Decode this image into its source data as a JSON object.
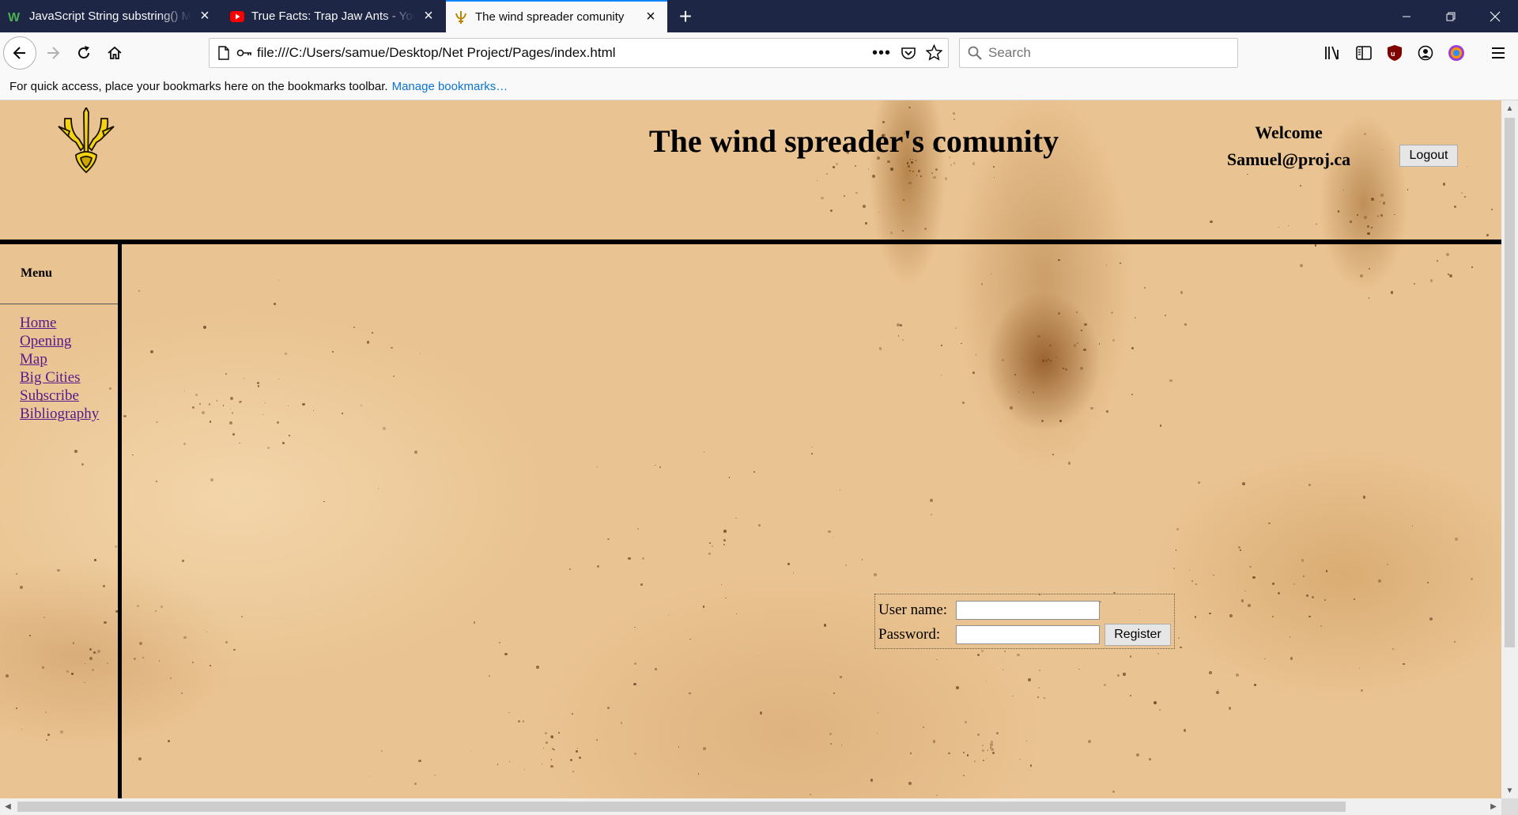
{
  "browser": {
    "tabs": [
      {
        "title": "JavaScript String substring() Me",
        "favicon": "w3schools-icon",
        "active": false
      },
      {
        "title": "True Facts: Trap Jaw Ants - YouT",
        "favicon": "youtube-icon",
        "active": false
      },
      {
        "title": "The wind spreader comunity",
        "favicon": "trident-icon",
        "active": true
      }
    ],
    "url": "file:///C:/Users/samue/Desktop/Net Project/Pages/index.html",
    "search_placeholder": "Search",
    "bookmarks_hint": "For quick access, place your bookmarks here on the bookmarks toolbar.",
    "bookmarks_link": "Manage bookmarks…",
    "colors": {
      "tabstrip": "#1d2645",
      "accent": "#0a84ff",
      "link": "#0a74d0"
    }
  },
  "page": {
    "title": "The wind spreader's comunity",
    "welcome": {
      "line1": "Welcome",
      "line2": "Samuel@proj.ca"
    },
    "logout_label": "Logout",
    "menu": {
      "title": "Menu",
      "items": [
        "Home",
        "Opening",
        "Map",
        "Big Cities",
        "Subscribe",
        "Bibliography"
      ]
    },
    "login_form": {
      "username_label": "User name:",
      "password_label": "Password:",
      "username_value": "",
      "password_value": "",
      "register_label": "Register"
    },
    "colors": {
      "background": "#e9c391",
      "visited_link": "#551a8b",
      "rule": "#000000"
    }
  }
}
